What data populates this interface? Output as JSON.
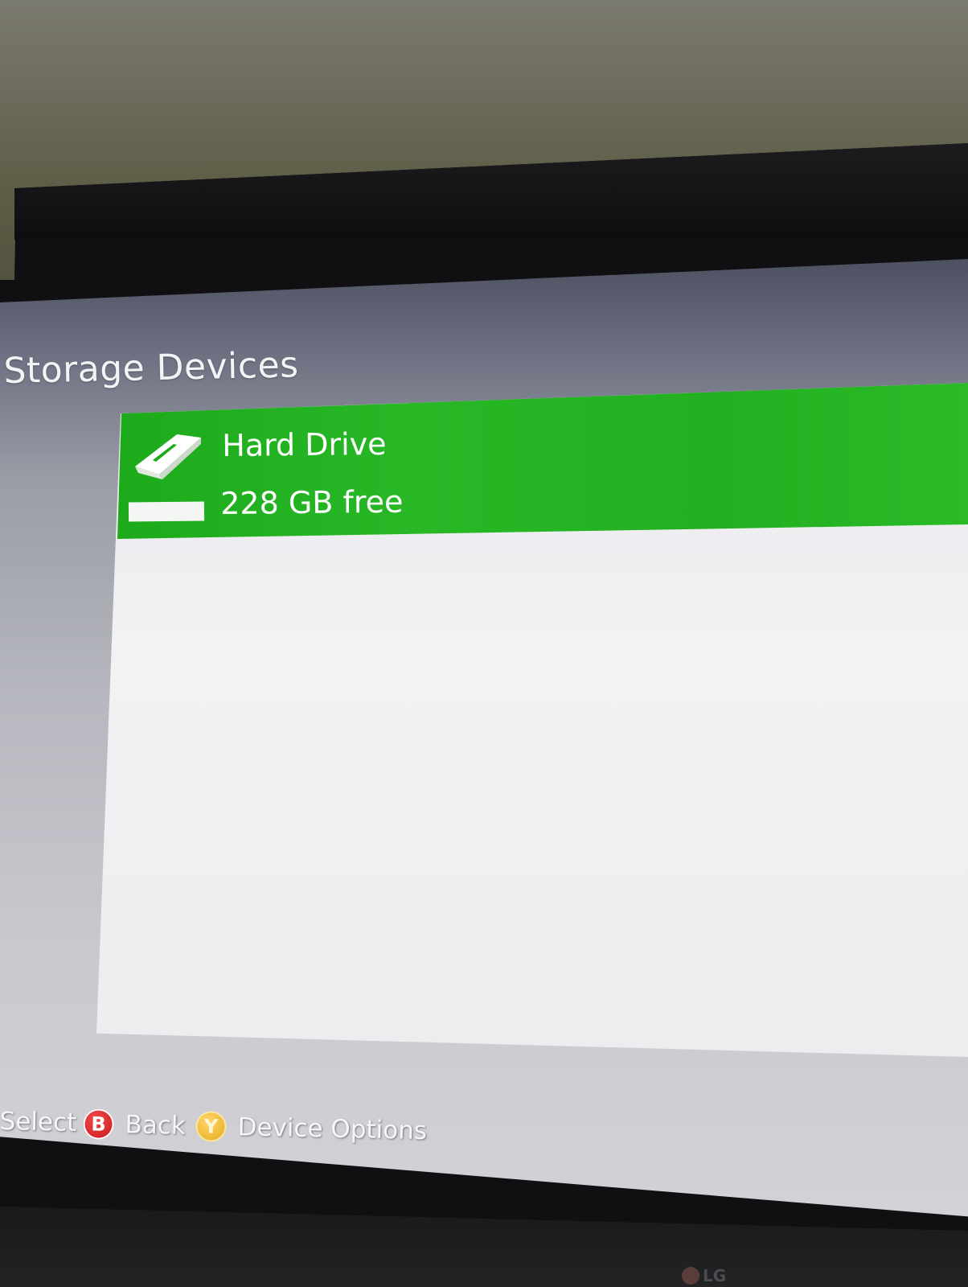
{
  "panel": {
    "title": "Storage Devices"
  },
  "devices": [
    {
      "name": "Hard Drive",
      "free_label": "228 GB free",
      "icon": "hard-drive-icon",
      "used_fraction": 0.0,
      "selected": true
    }
  ],
  "hints": {
    "select_label": "Select",
    "back_button": "B",
    "back_label": "Back",
    "options_button": "Y",
    "options_label": "Device Options"
  },
  "tv": {
    "brand": "LG"
  },
  "colors": {
    "selection_green": "#22b020",
    "b_button": "#d41a1e",
    "y_button": "#f0b429"
  }
}
